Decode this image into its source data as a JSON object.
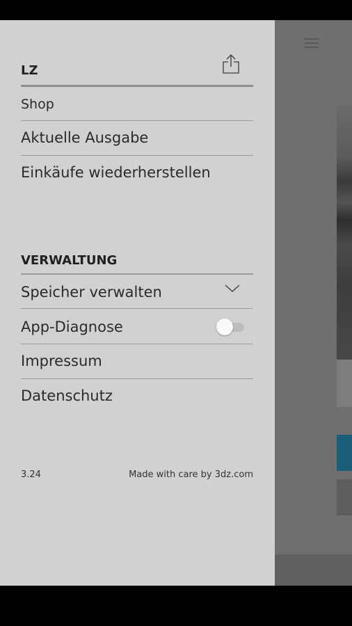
{
  "drawer": {
    "header": {
      "title": "LZ",
      "share_icon": "share-icon"
    },
    "menu": [
      {
        "label": "Shop"
      },
      {
        "label": "Aktuelle Ausgabe"
      },
      {
        "label": "Einkäufe wiederherstellen"
      }
    ],
    "admin": {
      "title": "VERWALTUNG",
      "storage": {
        "label": "Speicher verwalten",
        "icon": "chevron-down-icon"
      },
      "diagnostics": {
        "label": "App-Diagnose",
        "enabled": false
      },
      "imprint": {
        "label": "Impressum"
      },
      "privacy": {
        "label": "Datenschutz"
      }
    },
    "footer": {
      "version": "3.24",
      "credit": "Made with care by 3dz.com"
    }
  },
  "background": {
    "menu_icon": "hamburger-menu-icon",
    "accent_color": "#1a5f7a"
  }
}
